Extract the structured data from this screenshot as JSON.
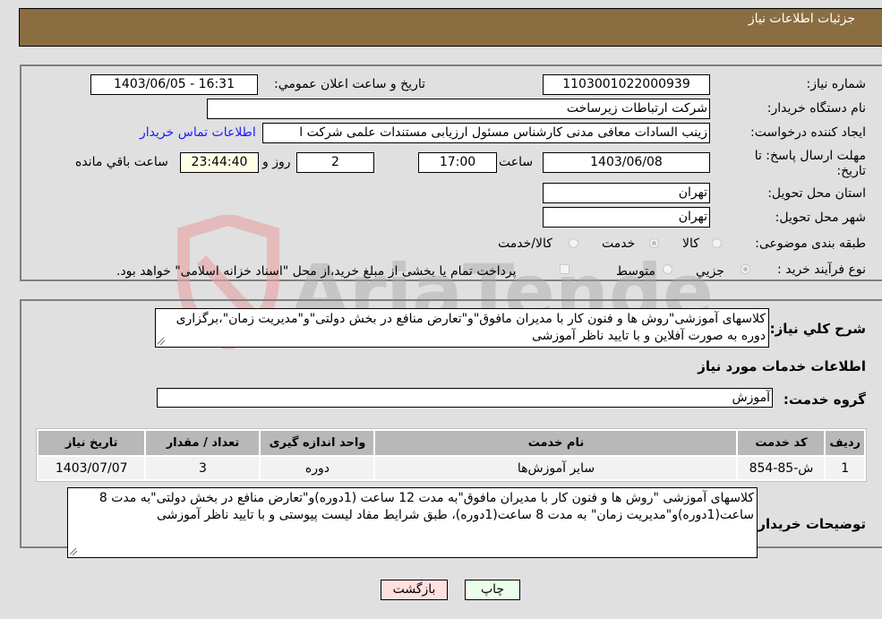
{
  "header": {
    "title": "جزئیات اطلاعات نیاز"
  },
  "fields": {
    "need_number": {
      "label": "شماره نیاز:",
      "value": "1103001022000939"
    },
    "announce_datetime": {
      "label": "تاريخ و ساعت اعلان عمومي:",
      "value": "1403/06/05 - 16:31"
    },
    "buyer_org": {
      "label": "نام دستگاه خريدار:",
      "value": "شرکت ارتباطات زيرساخت"
    },
    "requester": {
      "label": "ايجاد کننده درخواست:",
      "value": "زينب السادات معافی مدنی کارشناس مسئول ارزيابی مستندات علمی شرکت ا",
      "contact_link": "اطلاعات تماس خريدار"
    },
    "deadline": {
      "label_line1": "مهلت ارسال پاسخ: تا",
      "label_line2": "تاريخ:",
      "date": "1403/06/08",
      "time_label": "ساعت",
      "time": "17:00",
      "days": "2",
      "days_label": "روز و",
      "remaining": "23:44:40",
      "remaining_label": "ساعت باقي مانده"
    },
    "province": {
      "label": "استان محل تحويل:",
      "value": "تهران"
    },
    "city": {
      "label": "شهر محل تحويل:",
      "value": "تهران"
    },
    "category": {
      "label": "طبقه بندی موضوعی:",
      "options": [
        "کالا",
        "خدمت",
        "کالا/خدمت"
      ],
      "selected": "خدمت"
    },
    "purchase_type": {
      "label": "نوع فرآيند خريد :",
      "options": [
        "جزيي",
        "متوسط"
      ],
      "selected": "جزيي",
      "payment_note": "پرداخت تمام يا بخشی از مبلغ خريد،از محل \"اسناد خزانه اسلامی\" خواهد بود."
    }
  },
  "summary": {
    "label": "شرح کلي نياز:",
    "value": "کلاسهای آموزشی\"روش ها و فنون کار با مديران مافوق\"و\"تعارض منافع در بخش دولتی\"و\"مديريت زمان\"،برگزاری دوره به صورت آفلاين و با تاييد ناظر آموزشی"
  },
  "services": {
    "section_title": "اطلاعات خدمات مورد نياز",
    "group_label": "گروه خدمت:",
    "group_value": "آموزش",
    "table": {
      "headers": [
        "رديف",
        "کد خدمت",
        "نام خدمت",
        "واحد اندازه گيری",
        "تعداد / مقدار",
        "تاريخ نياز"
      ],
      "rows": [
        [
          "1",
          "ش-85-854",
          "ساير آموزش‌ها",
          "دوره",
          "3",
          "1403/07/07"
        ]
      ]
    }
  },
  "buyer_notes": {
    "label": "توضيحات خريدار:",
    "value": "کلاسهای آموزشی \"روش ها و فنون کار با مديران مافوق\"به مدت 12 ساعت (1دوره)و\"تعارض منافع در بخش دولتی\"به مدت 8 ساعت(1دوره)و\"مديريت زمان\" به مدت 8 ساعت(1دوره)، طبق شرايط مفاد ليست پيوستی و با تاييد ناظر آموزشی"
  },
  "buttons": {
    "print": "چاپ",
    "back": "بازگشت"
  },
  "watermark": {
    "text": "AriaTender.neT"
  },
  "colors": {
    "header_bg": "#8b6d42",
    "print_bg": "#eaffea",
    "back_bg": "#ffe0e0",
    "remaining_bg": "#ffffe6",
    "link": "#1a1aff"
  }
}
